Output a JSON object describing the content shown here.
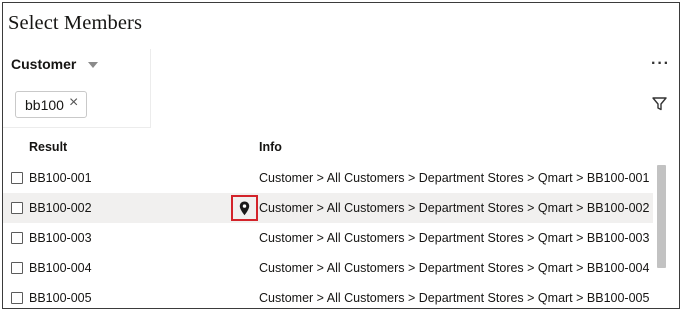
{
  "dialog": {
    "title": "Select Members"
  },
  "dimension": {
    "label": "Customer",
    "chip": "bb100"
  },
  "table": {
    "headers": {
      "result": "Result",
      "info": "Info"
    },
    "rows": [
      {
        "result": "BB100-001",
        "info": "Customer > All Customers > Department Stores > Qmart > BB100-001"
      },
      {
        "result": "BB100-002",
        "info": "Customer > All Customers > Department Stores > Qmart > BB100-002"
      },
      {
        "result": "BB100-003",
        "info": "Customer > All Customers > Department Stores > Qmart > BB100-003"
      },
      {
        "result": "BB100-004",
        "info": "Customer > All Customers > Department Stores > Qmart > BB100-004"
      },
      {
        "result": "BB100-005",
        "info": "Customer > All Customers > Department Stores > Qmart > BB100-005"
      }
    ]
  },
  "icons": {
    "more": "more-horizontal-icon",
    "filter": "filter-icon",
    "pin": "map-pin-icon",
    "remove": "close-icon"
  },
  "colors": {
    "highlight_border": "#d3232a",
    "row_highlight": "#f1f0ef"
  }
}
